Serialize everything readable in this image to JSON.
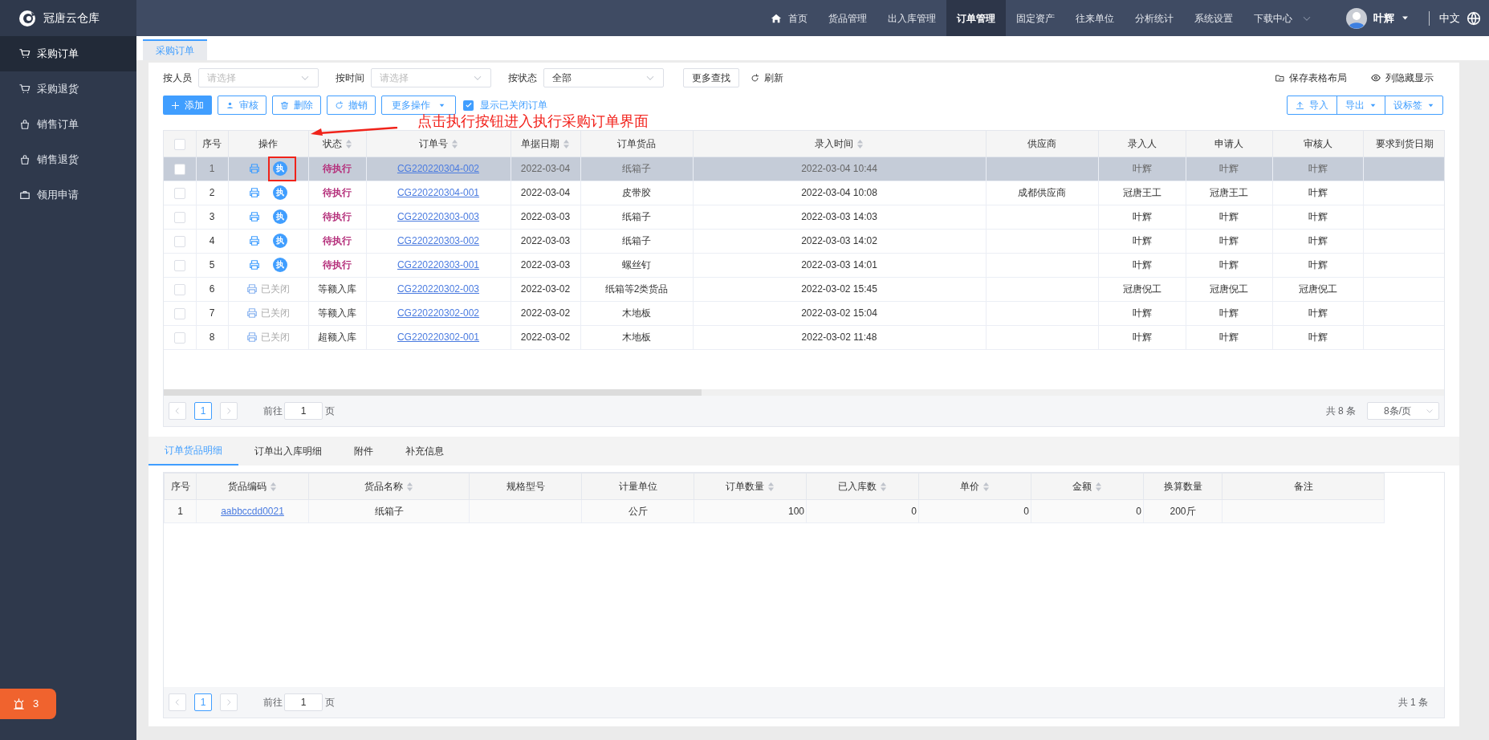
{
  "app": {
    "title": "冠唐云仓库"
  },
  "nav": [
    {
      "label": "首页",
      "kind": "home",
      "selected": false
    },
    {
      "label": "货品管理",
      "kind": "plain",
      "selected": false
    },
    {
      "label": "出入库管理",
      "kind": "plain",
      "selected": false
    },
    {
      "label": "订单管理",
      "kind": "plain",
      "selected": true
    },
    {
      "label": "固定资产",
      "kind": "plain",
      "selected": false
    },
    {
      "label": "往来单位",
      "kind": "plain",
      "selected": false
    },
    {
      "label": "分析统计",
      "kind": "plain",
      "selected": false
    },
    {
      "label": "系统设置",
      "kind": "plain",
      "selected": false
    },
    {
      "label": "下载中心",
      "kind": "dropdown",
      "selected": false
    }
  ],
  "user": {
    "name": "叶辉"
  },
  "language": "中文",
  "sidebar": {
    "items": [
      {
        "label": "采购订单",
        "kind": "cart",
        "selected": true
      },
      {
        "label": "采购退货",
        "kind": "cart",
        "selected": false
      },
      {
        "label": "销售订单",
        "kind": "bag",
        "selected": false
      },
      {
        "label": "销售退货",
        "kind": "bag",
        "selected": false
      },
      {
        "label": "领用申请",
        "kind": "case",
        "selected": false
      }
    ],
    "alert_count": "3"
  },
  "page_tabs": [
    {
      "label": "采购订单",
      "selected": true
    }
  ],
  "filters": [
    {
      "label": "按人员",
      "placeholder": "请选择"
    },
    {
      "label": "按时间",
      "placeholder": "请选择"
    },
    {
      "label": "按状态",
      "value": "全部"
    }
  ],
  "more_search": "更多查找",
  "refresh": "刷新",
  "save_layout": "保存表格布局",
  "column_visibility": "列隐藏显示",
  "toolbar": [
    {
      "label": "添加",
      "kind": "add"
    },
    {
      "label": "审核",
      "kind": "review"
    },
    {
      "label": "删除",
      "kind": "delete"
    },
    {
      "label": "撤销",
      "kind": "revoke"
    },
    {
      "label": "更多操作",
      "kind": "more"
    }
  ],
  "show_closed": {
    "label": "显示已关闭订单",
    "checked": true
  },
  "toolbar_right": [
    {
      "label": "导入",
      "kind": "import"
    },
    {
      "label": "导出",
      "kind": "dropdown"
    },
    {
      "label": "设标签",
      "kind": "dropdown"
    }
  ],
  "annotation": {
    "text": "点击执行按钮进入执行采购订单界面"
  },
  "table": {
    "select_all_checked": false,
    "columns": [
      {
        "label": "序号",
        "sortable": false
      },
      {
        "label": "操作",
        "sortable": false
      },
      {
        "label": "状态",
        "sortable": true
      },
      {
        "label": "订单号",
        "sortable": true
      },
      {
        "label": "单据日期",
        "sortable": true
      },
      {
        "label": "订单货品",
        "sortable": false
      },
      {
        "label": "录入时间",
        "sortable": true
      },
      {
        "label": "供应商",
        "sortable": false
      },
      {
        "label": "录入人",
        "sortable": false
      },
      {
        "label": "申请人",
        "sortable": false
      },
      {
        "label": "审核人",
        "sortable": false
      },
      {
        "label": "要求到货日期",
        "sortable": false
      }
    ],
    "rows": [
      {
        "selected": true,
        "checked": false,
        "index": "1",
        "action": {
          "kind": "execute",
          "label": "执"
        },
        "status": {
          "kind": "pending",
          "text": "待执行"
        },
        "order_no": "CG220220304-002",
        "date": "2022-03-04",
        "goods": "纸箱子",
        "entry_time": "2022-03-04 10:44",
        "entered_by": "叶辉",
        "applicant": "叶辉",
        "reviewer": "叶辉"
      },
      {
        "selected": false,
        "checked": false,
        "index": "2",
        "action": {
          "kind": "execute",
          "label": "执"
        },
        "status": {
          "kind": "pending",
          "text": "待执行"
        },
        "order_no": "CG220220304-001",
        "date": "2022-03-04",
        "goods": "皮带胶",
        "entry_time": "2022-03-04 10:08",
        "supplier": "成都供应商",
        "entered_by": "冠唐王工",
        "applicant": "冠唐王工",
        "reviewer": "叶辉"
      },
      {
        "selected": false,
        "checked": false,
        "index": "3",
        "action": {
          "kind": "execute",
          "label": "执"
        },
        "status": {
          "kind": "pending",
          "text": "待执行"
        },
        "order_no": "CG220220303-003",
        "date": "2022-03-03",
        "goods": "纸箱子",
        "entry_time": "2022-03-03 14:03",
        "entered_by": "叶辉",
        "applicant": "叶辉",
        "reviewer": "叶辉"
      },
      {
        "selected": false,
        "checked": false,
        "index": "4",
        "action": {
          "kind": "execute",
          "label": "执"
        },
        "status": {
          "kind": "pending",
          "text": "待执行"
        },
        "order_no": "CG220220303-002",
        "date": "2022-03-03",
        "goods": "纸箱子",
        "entry_time": "2022-03-03 14:02",
        "entered_by": "叶辉",
        "applicant": "叶辉",
        "reviewer": "叶辉"
      },
      {
        "selected": false,
        "checked": false,
        "index": "5",
        "action": {
          "kind": "execute",
          "label": "执"
        },
        "status": {
          "kind": "pending",
          "text": "待执行"
        },
        "order_no": "CG220220303-001",
        "date": "2022-03-03",
        "goods": "螺丝钉",
        "entry_time": "2022-03-03 14:01",
        "entered_by": "叶辉",
        "applicant": "叶辉",
        "reviewer": "叶辉"
      },
      {
        "selected": false,
        "checked": false,
        "index": "6",
        "action": {
          "kind": "closed",
          "label": "已关闭"
        },
        "status": {
          "kind": "done",
          "text": "等额入库"
        },
        "order_no": "CG220220302-003",
        "date": "2022-03-02",
        "goods": "纸箱等2类货品",
        "entry_time": "2022-03-02 15:45",
        "entered_by": "冠唐倪工",
        "applicant": "冠唐倪工",
        "reviewer": "冠唐倪工"
      },
      {
        "selected": false,
        "checked": false,
        "index": "7",
        "action": {
          "kind": "closed",
          "label": "已关闭"
        },
        "status": {
          "kind": "done",
          "text": "等额入库"
        },
        "order_no": "CG220220302-002",
        "date": "2022-03-02",
        "goods": "木地板",
        "entry_time": "2022-03-02 15:04",
        "entered_by": "叶辉",
        "applicant": "叶辉",
        "reviewer": "叶辉"
      },
      {
        "selected": false,
        "checked": false,
        "index": "8",
        "action": {
          "kind": "closed",
          "label": "已关闭"
        },
        "status": {
          "kind": "done",
          "text": "超额入库"
        },
        "order_no": "CG220220302-001",
        "date": "2022-03-02",
        "goods": "木地板",
        "entry_time": "2022-03-02 11:48",
        "entered_by": "叶辉",
        "applicant": "叶辉",
        "reviewer": "叶辉"
      }
    ]
  },
  "pagination": {
    "current_page": "1",
    "goto_label": "前往",
    "goto_value": "1",
    "page_suffix": "页",
    "total": "共 8 条",
    "page_size": "8条/页"
  },
  "detail_tabs": [
    {
      "label": "订单货品明细",
      "selected": true
    },
    {
      "label": "订单出入库明细",
      "selected": false
    },
    {
      "label": "附件",
      "selected": false
    },
    {
      "label": "补充信息",
      "selected": false
    }
  ],
  "detail_table": {
    "columns": [
      {
        "label": "序号",
        "sortable": false
      },
      {
        "label": "货品编码",
        "sortable": true
      },
      {
        "label": "货品名称",
        "sortable": true
      },
      {
        "label": "规格型号",
        "sortable": false
      },
      {
        "label": "计量单位",
        "sortable": false
      },
      {
        "label": "订单数量",
        "sortable": true
      },
      {
        "label": "已入库数",
        "sortable": true
      },
      {
        "label": "单价",
        "sortable": true
      },
      {
        "label": "金额",
        "sortable": true
      },
      {
        "label": "换算数量",
        "sortable": false
      },
      {
        "label": "备注",
        "sortable": false
      }
    ],
    "rows": [
      {
        "index": "1",
        "code": "aabbccdd0021",
        "name": "纸箱子",
        "unit": "公斤",
        "quantity": "100",
        "received": "0",
        "price": "0",
        "amount": "0",
        "converted": "200斤"
      }
    ]
  },
  "detail_pagination": {
    "current_page": "1",
    "goto_label": "前往",
    "goto_value": "1",
    "page_suffix": "页",
    "total": "共 1 条"
  }
}
